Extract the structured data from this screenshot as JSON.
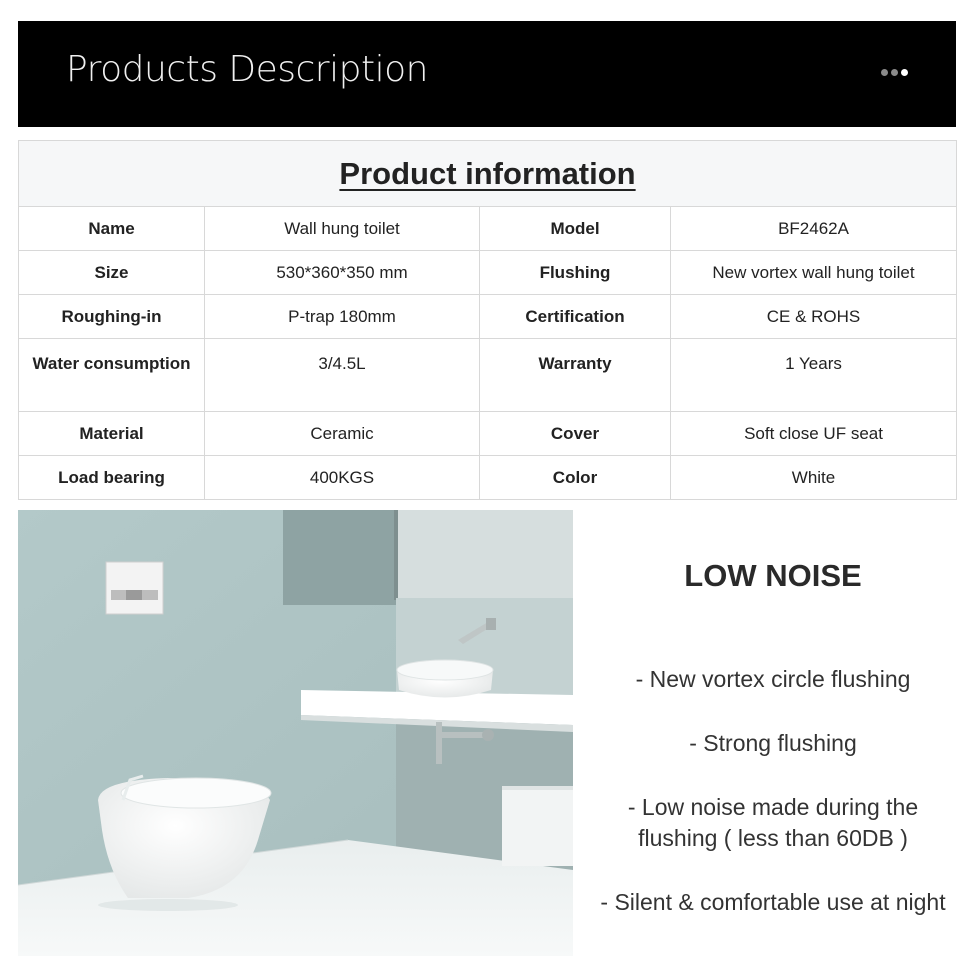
{
  "banner": {
    "title": "Products Description",
    "dots": 3
  },
  "table": {
    "title": "Product information",
    "rows": [
      {
        "l1": "Name",
        "v1": "Wall hung toilet",
        "l2": "Model",
        "v2": "BF2462A"
      },
      {
        "l1": "Size",
        "v1": "530*360*350 mm",
        "l2": "Flushing",
        "v2": "New vortex wall hung toilet"
      },
      {
        "l1": "Roughing-in",
        "v1": "P-trap 180mm",
        "l2": "Certification",
        "v2": "CE & ROHS"
      },
      {
        "l1": "Water consumption",
        "v1": "3/4.5L",
        "l2": "Warranty",
        "v2": "1 Years"
      },
      {
        "l1": "Material",
        "v1": "Ceramic",
        "l2": "Cover",
        "v2": "Soft close UF seat"
      },
      {
        "l1": "Load bearing",
        "v1": "400KGS",
        "l2": "Color",
        "v2": "White"
      }
    ]
  },
  "features": {
    "title": "LOW NOISE",
    "items": [
      "- New vortex circle flushing",
      "- Strong flushing",
      "- Low noise made during the flushing ( less than 60DB )",
      "- Silent & comfortable use at night"
    ]
  }
}
